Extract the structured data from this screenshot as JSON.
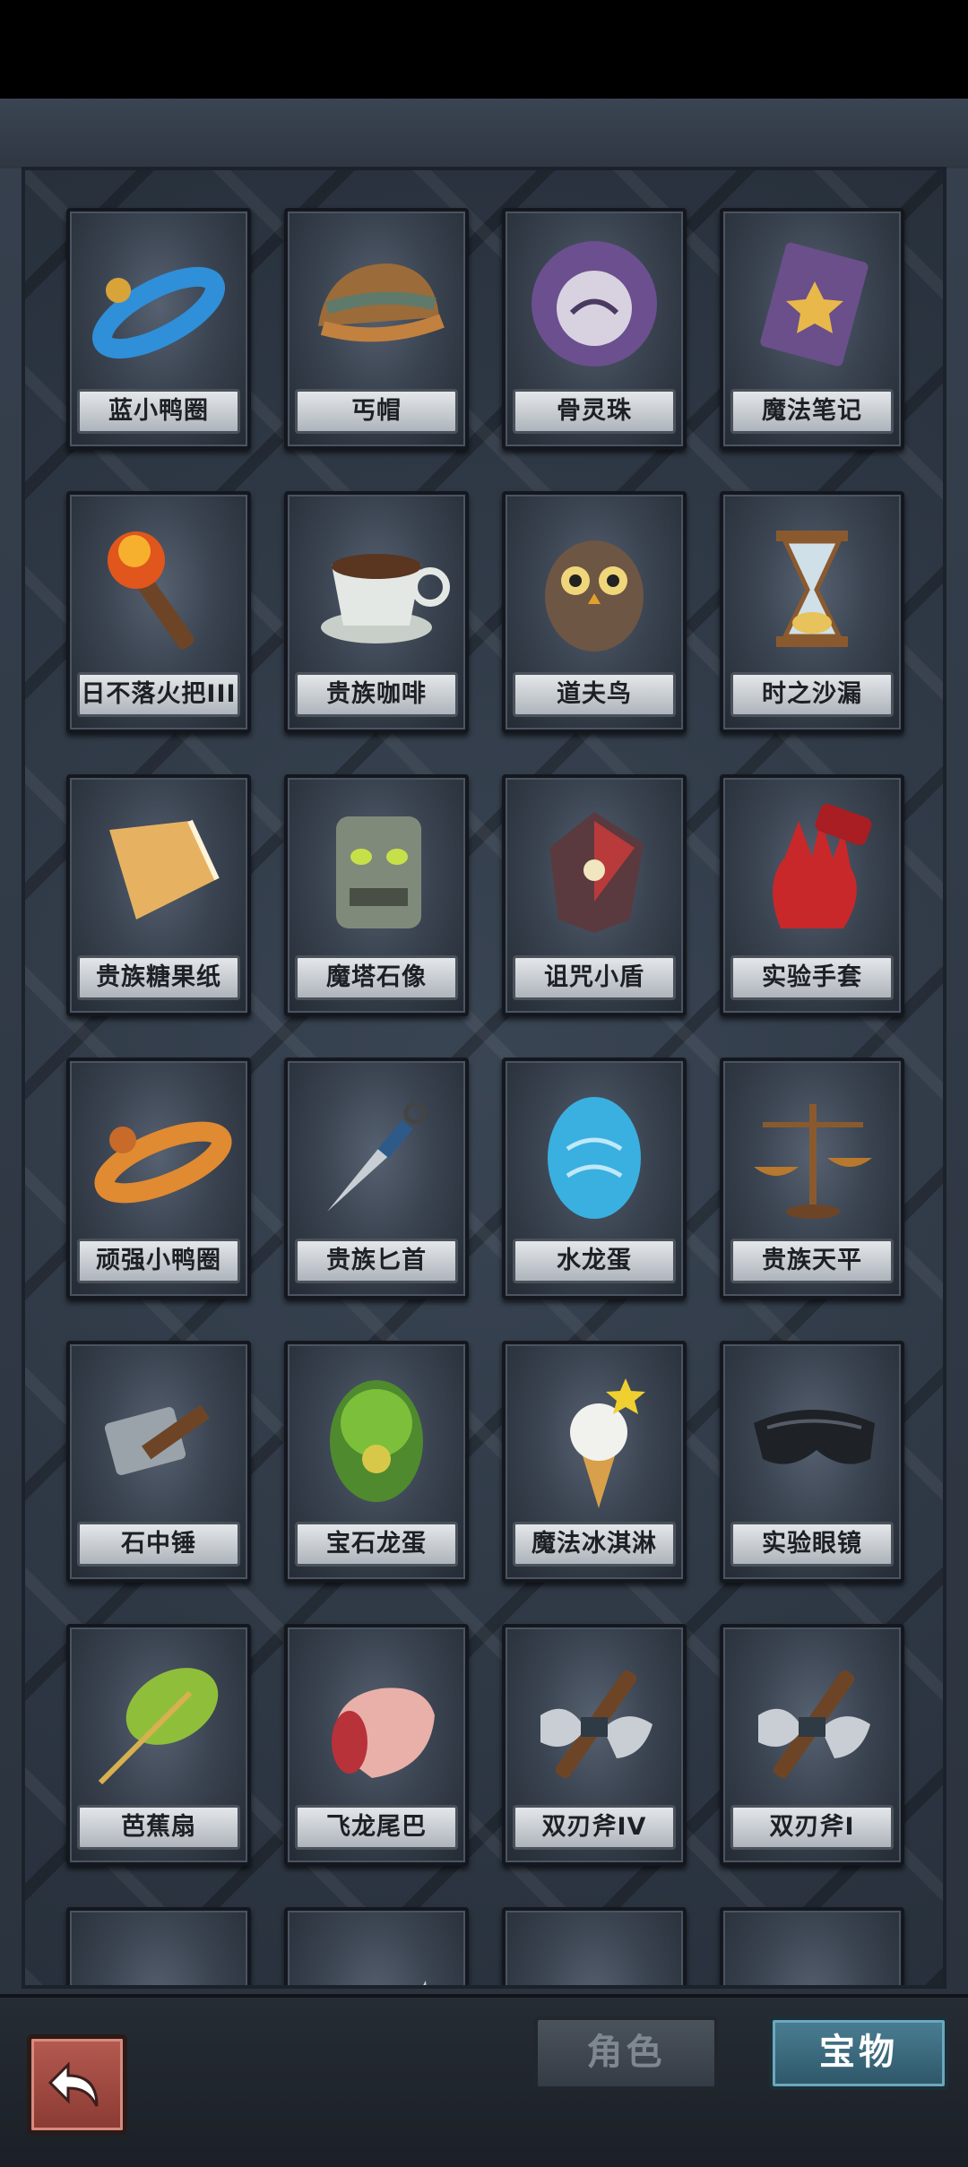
{
  "tabs": {
    "role": "角色",
    "treasure": "宝物"
  },
  "items": [
    {
      "name": "蓝小鸭圈",
      "icon": "blue-duck-ring-icon"
    },
    {
      "name": "丐帽",
      "icon": "beggar-hat-icon"
    },
    {
      "name": "骨灵珠",
      "icon": "bone-spirit-orb-icon"
    },
    {
      "name": "魔法笔记",
      "icon": "magic-notebook-icon"
    },
    {
      "name": "日不落火把III",
      "icon": "torch-icon"
    },
    {
      "name": "贵族咖啡",
      "icon": "coffee-cup-icon"
    },
    {
      "name": "道夫鸟",
      "icon": "owl-icon"
    },
    {
      "name": "时之沙漏",
      "icon": "hourglass-icon"
    },
    {
      "name": "贵族糖果纸",
      "icon": "candy-wrapper-icon"
    },
    {
      "name": "魔塔石像",
      "icon": "stone-statue-icon"
    },
    {
      "name": "诅咒小盾",
      "icon": "cursed-shield-icon"
    },
    {
      "name": "实验手套",
      "icon": "red-glove-icon"
    },
    {
      "name": "顽强小鸭圈",
      "icon": "orange-duck-ring-icon"
    },
    {
      "name": "贵族匕首",
      "icon": "dagger-icon"
    },
    {
      "name": "水龙蛋",
      "icon": "water-dragon-egg-icon"
    },
    {
      "name": "贵族天平",
      "icon": "balance-scale-icon"
    },
    {
      "name": "石中锤",
      "icon": "hammer-icon"
    },
    {
      "name": "宝石龙蛋",
      "icon": "gem-dragon-egg-icon"
    },
    {
      "name": "魔法冰淇淋",
      "icon": "ice-cream-icon"
    },
    {
      "name": "实验眼镜",
      "icon": "goggles-icon"
    },
    {
      "name": "芭蕉扇",
      "icon": "leaf-fan-icon"
    },
    {
      "name": "飞龙尾巴",
      "icon": "dragon-tail-icon"
    },
    {
      "name": "双刃斧IV",
      "icon": "double-axe-icon"
    },
    {
      "name": "双刃斧I",
      "icon": "double-axe-icon"
    },
    {
      "name": "",
      "icon": "crystal-ball-icon"
    },
    {
      "name": "",
      "icon": "blade-icon"
    },
    {
      "name": "",
      "icon": "golden-club-icon"
    },
    {
      "name": "",
      "icon": "meat-bone-icon"
    }
  ],
  "colors": {
    "back_button": "#a84a42",
    "treasure_tab": "#3f6f83",
    "role_tab": "#404851"
  }
}
